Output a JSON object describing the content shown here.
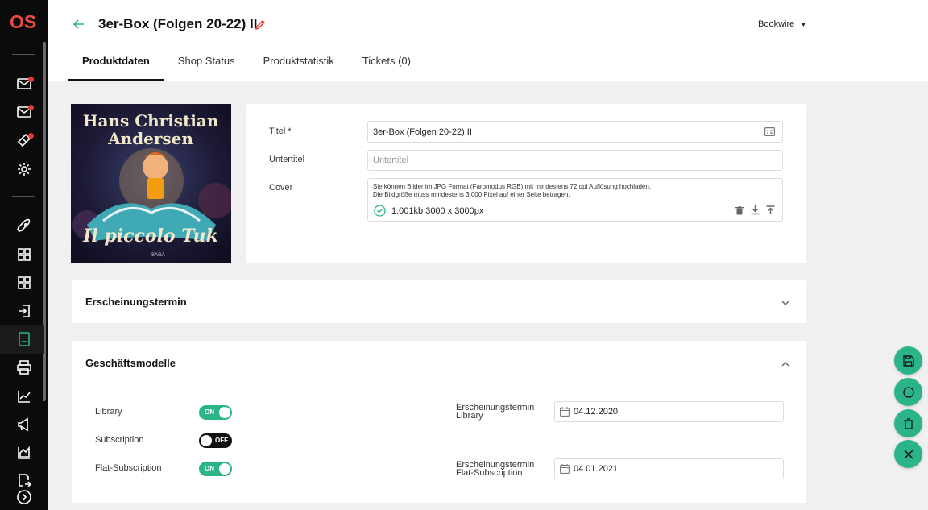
{
  "brand": {
    "logo_text": "OS",
    "accent": "#2bb38a",
    "logo_color": "#e84a3f"
  },
  "header": {
    "title": "3er-Box (Folgen 20-22) II",
    "publisher": "Bookwire"
  },
  "tabs": [
    {
      "label": "Produktdaten",
      "active": true
    },
    {
      "label": "Shop Status",
      "active": false
    },
    {
      "label": "Produktstatistik",
      "active": false
    },
    {
      "label": "Tickets (0)",
      "active": false
    }
  ],
  "cover_art": {
    "title_line1": "Hans Christian",
    "title_line2": "Andersen",
    "subtitle": "Il piccolo Tuk",
    "publisher_mark": "SAGA"
  },
  "product": {
    "title_label": "Titel *",
    "title_value": "3er-Box (Folgen 20-22) II",
    "subtitle_label": "Untertitel",
    "subtitle_placeholder": "Untertitel",
    "cover_label": "Cover",
    "cover_note_line1": "Sie können Bilder im JPG Format (Farbmodus RGB) mit mindestens 72 dpi Auflösung hochladen.",
    "cover_note_line2": "Die Bildgröße muss mindestens 3.000 Pixel auf einer Seite betragen.",
    "cover_file_info": "1.001kb 3000 x 3000px"
  },
  "sections": {
    "release": {
      "title": "Erscheinungstermin"
    },
    "business": {
      "title": "Geschäftsmodelle",
      "models": [
        {
          "label": "Library",
          "state": "ON",
          "on": true
        },
        {
          "label": "Subscription",
          "state": "OFF",
          "on": false
        },
        {
          "label": "Flat-Subscription",
          "state": "ON",
          "on": true
        }
      ],
      "dates": [
        {
          "label_line1": "Erscheinungstermin",
          "label_line2": "Library",
          "value": "04.12.2020"
        },
        {
          "label_line1": "Erscheinungstermin",
          "label_line2": "Flat-Subscription",
          "value": "04.01.2021"
        }
      ]
    }
  },
  "icons": {
    "sidebar": [
      "mail-icon",
      "mail-icon",
      "ticket-icon",
      "gear-icon",
      "rocket-icon",
      "grid-icon",
      "grid-icon",
      "login-icon",
      "book-icon",
      "printer-icon",
      "chart-line-icon",
      "megaphone-icon",
      "chart-area-icon",
      "export-icon",
      "chevron-right-circle-icon"
    ],
    "fabs": [
      "save-icon",
      "circle-icon",
      "trash-icon",
      "close-icon"
    ]
  }
}
